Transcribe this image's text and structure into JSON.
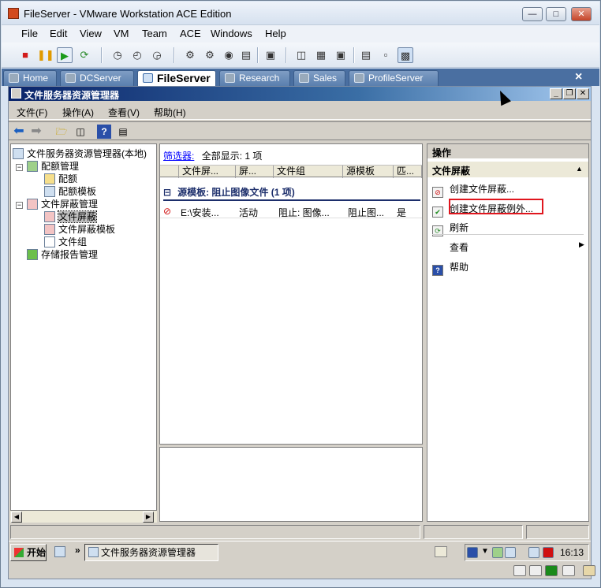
{
  "vm": {
    "title": "FileServer - VMware Workstation ACE Edition",
    "menu": [
      "File",
      "Edit",
      "View",
      "VM",
      "Team",
      "ACE",
      "Windows",
      "Help"
    ],
    "tabs": [
      {
        "label": "Home",
        "icon": "home-icon"
      },
      {
        "label": "DCServer",
        "icon": "vm-icon"
      },
      {
        "label": "FileServer",
        "icon": "vm-icon",
        "active": true
      },
      {
        "label": "Research",
        "icon": "team-icon"
      },
      {
        "label": "Sales",
        "icon": "team-icon"
      },
      {
        "label": "ProfileServer",
        "icon": "vm-icon"
      }
    ],
    "tabs_close": "×"
  },
  "mmc": {
    "title": "文件服务器资源管理器",
    "menu": [
      "文件(F)",
      "操作(A)",
      "查看(V)",
      "帮助(H)"
    ],
    "tree": {
      "root": "文件服务器资源管理器(本地)",
      "quota": "配额管理",
      "quota_children": [
        "配额",
        "配额模板"
      ],
      "screen": "文件屏蔽管理",
      "screen_children": [
        "文件屏蔽",
        "文件屏蔽模板",
        "文件组"
      ],
      "reports": "存储报告管理"
    },
    "filter": {
      "link": "筛选器:",
      "text": "全部显示: 1 项"
    },
    "columns": [
      "文件屏...",
      "屏...",
      "文件组",
      "源模板",
      "匹..."
    ],
    "group_row": "源模板: 阻止图像文件 (1 项)",
    "row": [
      "E:\\安装...",
      "活动",
      "阻止: 图像...",
      "阻止图...",
      "是"
    ],
    "actions": {
      "header": "操作",
      "section": "文件屏蔽",
      "items": [
        "创建文件屏蔽...",
        "创建文件屏蔽例外...",
        "刷新",
        "查看",
        "帮助"
      ]
    }
  },
  "taskbar": {
    "start": "开始",
    "chevron": "»",
    "task": "文件服务器资源管理器",
    "clock": "16:13"
  },
  "colors": {
    "mmc_title_start": "#0a246a",
    "vm_tabbar": "#4a6fa1",
    "highlight_box": "#e0161e"
  }
}
